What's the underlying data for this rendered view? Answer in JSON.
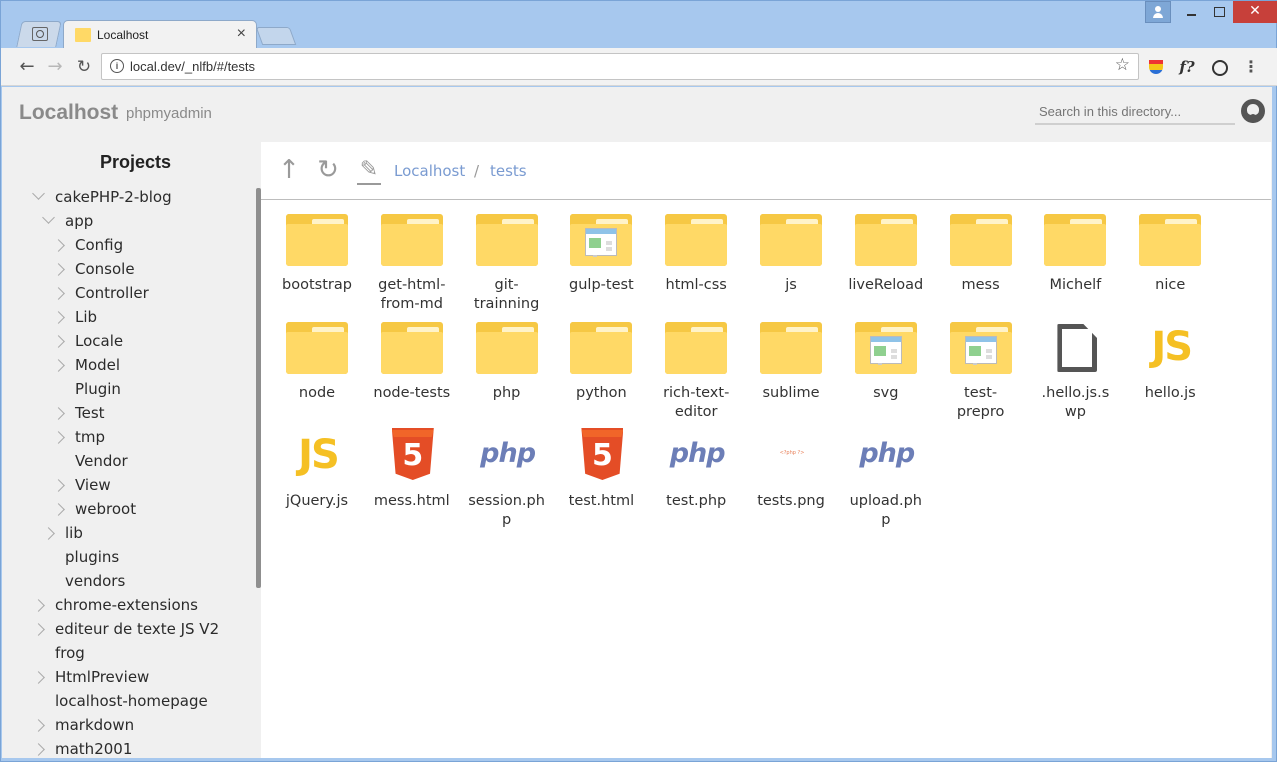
{
  "browser": {
    "tab_title": "Localhost",
    "tab_close": "×",
    "url": "local.dev/_nlfb/#/tests",
    "close_glyph": "✕"
  },
  "header": {
    "brand": "Localhost",
    "link": "phpmyadmin",
    "search_placeholder": "Search in this directory..."
  },
  "sidebar": {
    "title": "Projects",
    "items": [
      {
        "label": "cakePHP-2-blog",
        "level": 0,
        "caret": "down"
      },
      {
        "label": "app",
        "level": 1,
        "caret": "down"
      },
      {
        "label": "Config",
        "level": 2,
        "caret": "right"
      },
      {
        "label": "Console",
        "level": 2,
        "caret": "right"
      },
      {
        "label": "Controller",
        "level": 2,
        "caret": "right"
      },
      {
        "label": "Lib",
        "level": 2,
        "caret": "right"
      },
      {
        "label": "Locale",
        "level": 2,
        "caret": "right"
      },
      {
        "label": "Model",
        "level": 2,
        "caret": "right"
      },
      {
        "label": "Plugin",
        "level": 2,
        "caret": "none"
      },
      {
        "label": "Test",
        "level": 2,
        "caret": "right"
      },
      {
        "label": "tmp",
        "level": 2,
        "caret": "right"
      },
      {
        "label": "Vendor",
        "level": 2,
        "caret": "none"
      },
      {
        "label": "View",
        "level": 2,
        "caret": "right"
      },
      {
        "label": "webroot",
        "level": 2,
        "caret": "right"
      },
      {
        "label": "lib",
        "level": 1,
        "caret": "right"
      },
      {
        "label": "plugins",
        "level": 1,
        "caret": "none"
      },
      {
        "label": "vendors",
        "level": 1,
        "caret": "none"
      },
      {
        "label": "chrome-extensions",
        "level": 0,
        "caret": "right"
      },
      {
        "label": "editeur de texte JS V2",
        "level": 0,
        "caret": "right"
      },
      {
        "label": "frog",
        "level": 0,
        "caret": "none"
      },
      {
        "label": "HtmlPreview",
        "level": 0,
        "caret": "right"
      },
      {
        "label": "localhost-homepage",
        "level": 0,
        "caret": "none"
      },
      {
        "label": "markdown",
        "level": 0,
        "caret": "right"
      },
      {
        "label": "math2001",
        "level": 0,
        "caret": "right"
      }
    ]
  },
  "breadcrumb": {
    "root": "Localhost",
    "separator": "/",
    "current": "tests"
  },
  "files": [
    {
      "name": "bootstrap",
      "kind": "folder"
    },
    {
      "name": "get-html-\nfrom-md",
      "kind": "folder"
    },
    {
      "name": "git-\ntrainning",
      "kind": "folder"
    },
    {
      "name": "gulp-test",
      "kind": "folder-preview"
    },
    {
      "name": "html-css",
      "kind": "folder"
    },
    {
      "name": "js",
      "kind": "folder"
    },
    {
      "name": "liveReload",
      "kind": "folder"
    },
    {
      "name": "mess",
      "kind": "folder"
    },
    {
      "name": "Michelf",
      "kind": "folder"
    },
    {
      "name": "nice",
      "kind": "folder"
    },
    {
      "name": "node",
      "kind": "folder"
    },
    {
      "name": "node-tests",
      "kind": "folder"
    },
    {
      "name": "php",
      "kind": "folder"
    },
    {
      "name": "python",
      "kind": "folder"
    },
    {
      "name": "rich-text-\neditor",
      "kind": "folder"
    },
    {
      "name": "sublime",
      "kind": "folder"
    },
    {
      "name": "svg",
      "kind": "folder-preview"
    },
    {
      "name": "test-\nprepro",
      "kind": "folder-preview"
    },
    {
      "name": ".hello.js.s\nwp",
      "kind": "file"
    },
    {
      "name": "hello.js",
      "kind": "js"
    },
    {
      "name": "jQuery.js",
      "kind": "js"
    },
    {
      "name": "mess.html",
      "kind": "html"
    },
    {
      "name": "session.ph\np",
      "kind": "php"
    },
    {
      "name": "test.html",
      "kind": "html"
    },
    {
      "name": "test.php",
      "kind": "php"
    },
    {
      "name": "tests.png",
      "kind": "png"
    },
    {
      "name": "upload.ph\np",
      "kind": "php"
    }
  ],
  "icon_text": {
    "js": "JS",
    "html": "5",
    "php": "php",
    "png": "&lt;?php          ?&gt;"
  },
  "colors": {
    "folder": "#ffd966",
    "link": "#7a9bd1",
    "html5": "#e44d26",
    "php": "#6c7eb7",
    "js": "#f5c024"
  }
}
